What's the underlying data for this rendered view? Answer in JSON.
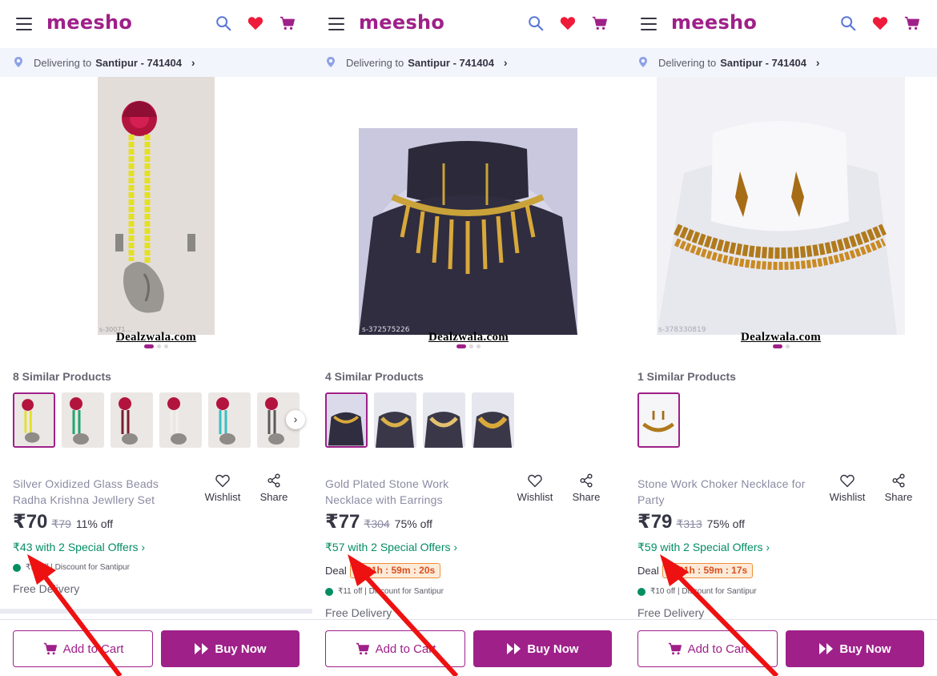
{
  "colors": {
    "brand": "#9f2089",
    "offer_green": "#038d63",
    "timer_orange": "#d9501f"
  },
  "header": {
    "logo": "meesho",
    "icons": [
      "menu-icon",
      "search-icon",
      "heart-icon",
      "cart-icon"
    ]
  },
  "delivery": {
    "prefix": "Delivering to",
    "location": "Santipur - 741404"
  },
  "watermark": "Dealzwala.com",
  "actions": {
    "wishlist": "Wishlist",
    "share": "Share"
  },
  "footer": {
    "add_to_cart": "Add to Cart",
    "buy_now": "Buy Now"
  },
  "panels": [
    {
      "image_id": "s-30071...",
      "similar": "8 Similar Products",
      "name": "Silver Oxidized Glass Beads Radha Krishna Jewllery Set",
      "price": "₹70",
      "mrp": "₹79",
      "discount": "11% off",
      "offer": "₹43 with 2 Special Offers ›",
      "deal_label": "",
      "deal_timer": "",
      "discount_line": "₹... off | Discount for Santipur",
      "free_delivery": "Free Delivery"
    },
    {
      "image_id": "s-372575226",
      "similar": "4 Similar Products",
      "name": "Gold Plated Stone Work Necklace with Earrings",
      "price": "₹77",
      "mrp": "₹304",
      "discount": "75% off",
      "offer": "₹57 with 2 Special Offers ›",
      "deal_label": "Deal",
      "deal_timer": "01h : 59m : 20s",
      "discount_line": "₹11 off | Discount for Santipur",
      "free_delivery": "Free Delivery"
    },
    {
      "image_id": "s-378330819",
      "similar": "1 Similar Products",
      "name": "Stone Work Choker Necklace for Party",
      "price": "₹79",
      "mrp": "₹313",
      "discount": "75% off",
      "offer": "₹59 with 2 Special Offers ›",
      "deal_label": "Deal",
      "deal_timer": "01h : 59m : 17s",
      "discount_line": "₹10 off | Discount for Santipur",
      "free_delivery": "Free Delivery"
    }
  ]
}
